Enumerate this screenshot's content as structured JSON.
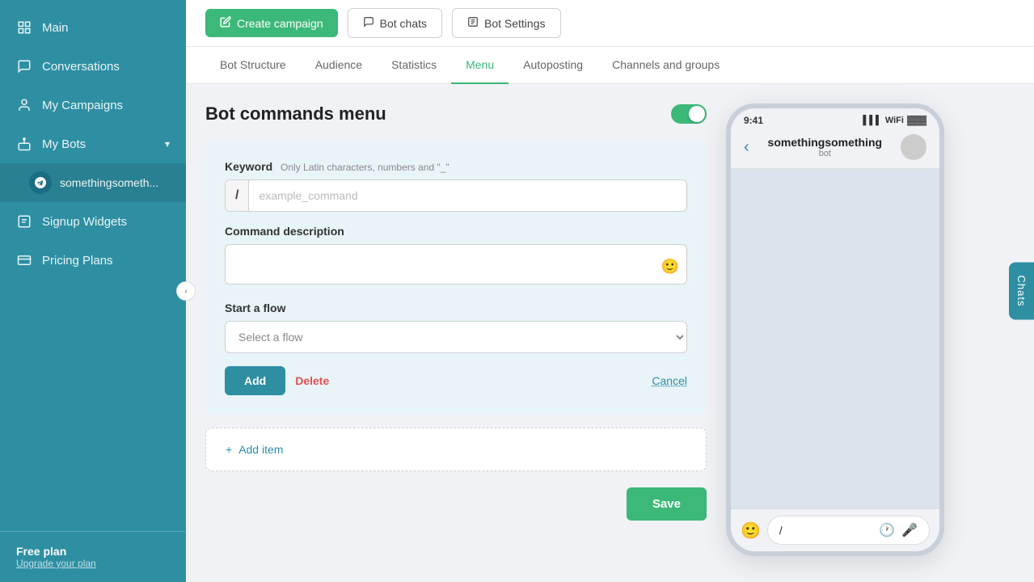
{
  "sidebar": {
    "items": [
      {
        "id": "main",
        "label": "Main",
        "icon": "grid"
      },
      {
        "id": "conversations",
        "label": "Conversations",
        "icon": "chat"
      },
      {
        "id": "my-campaigns",
        "label": "My Campaigns",
        "icon": "person"
      },
      {
        "id": "my-bots",
        "label": "My Bots",
        "icon": "bot",
        "hasChevron": true
      },
      {
        "id": "bot-name",
        "label": "somethingsometh...",
        "icon": "telegram",
        "isBot": true
      },
      {
        "id": "signup-widgets",
        "label": "Signup Widgets",
        "icon": "signup"
      },
      {
        "id": "pricing-plans",
        "label": "Pricing Plans",
        "icon": "pricing"
      }
    ],
    "free_plan": "Free plan",
    "upgrade_label": "Upgrade your plan"
  },
  "topbar": {
    "create_label": "Create campaign",
    "bot_chats_label": "Bot chats",
    "bot_settings_label": "Bot Settings"
  },
  "tabs": [
    {
      "id": "bot-structure",
      "label": "Bot Structure"
    },
    {
      "id": "audience",
      "label": "Audience"
    },
    {
      "id": "statistics",
      "label": "Statistics"
    },
    {
      "id": "menu",
      "label": "Menu",
      "active": true
    },
    {
      "id": "autoposting",
      "label": "Autoposting"
    },
    {
      "id": "channels-groups",
      "label": "Channels and groups"
    }
  ],
  "main": {
    "page_title": "Bot commands menu",
    "command_card": {
      "keyword_label": "Keyword",
      "keyword_note": "Only Latin characters, numbers and \"_\"",
      "keyword_prefix": "/",
      "keyword_placeholder": "example_command",
      "description_label": "Command description",
      "description_placeholder": "",
      "start_flow_label": "Start a flow",
      "select_flow_placeholder": "Select a flow",
      "add_btn": "Add",
      "delete_btn": "Delete",
      "cancel_btn": "Cancel"
    },
    "add_item_label": "+ Add item",
    "save_btn": "Save"
  },
  "phone": {
    "time": "9:41",
    "bot_name": "somethingsomething",
    "bot_sub": "bot",
    "slash_text": "/"
  },
  "chats_tab": "Chats"
}
